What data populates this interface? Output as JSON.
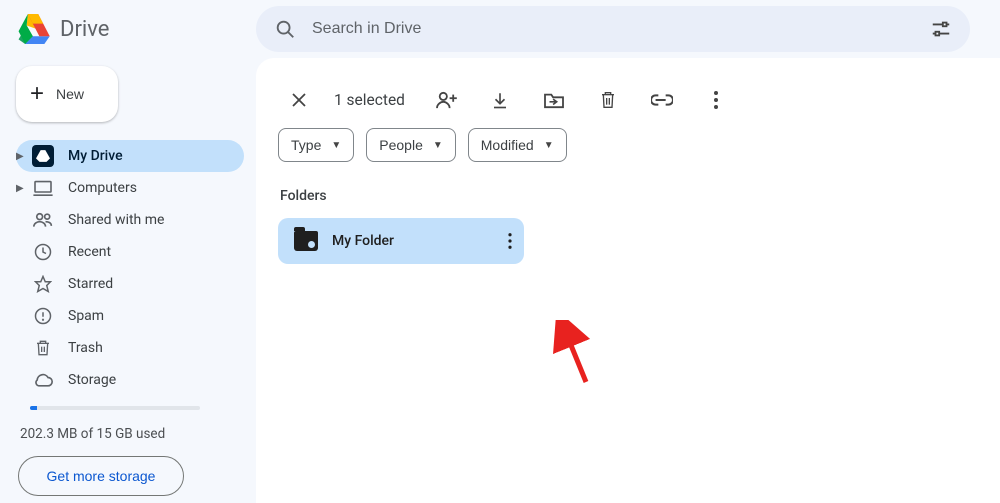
{
  "brand": {
    "label": "Drive"
  },
  "search": {
    "placeholder": "Search in Drive"
  },
  "new_button": {
    "label": "New"
  },
  "sidebar": {
    "items": [
      {
        "label": "My Drive"
      },
      {
        "label": "Computers"
      },
      {
        "label": "Shared with me"
      },
      {
        "label": "Recent"
      },
      {
        "label": "Starred"
      },
      {
        "label": "Spam"
      },
      {
        "label": "Trash"
      },
      {
        "label": "Storage"
      }
    ],
    "storage_text": "202.3 MB of 15 GB used",
    "get_storage": "Get more storage"
  },
  "selection": {
    "count_label": "1 selected"
  },
  "filters": {
    "type": "Type",
    "people": "People",
    "modified": "Modified"
  },
  "folders_section": {
    "title": "Folders"
  },
  "folders": [
    {
      "name": "My Folder"
    }
  ]
}
